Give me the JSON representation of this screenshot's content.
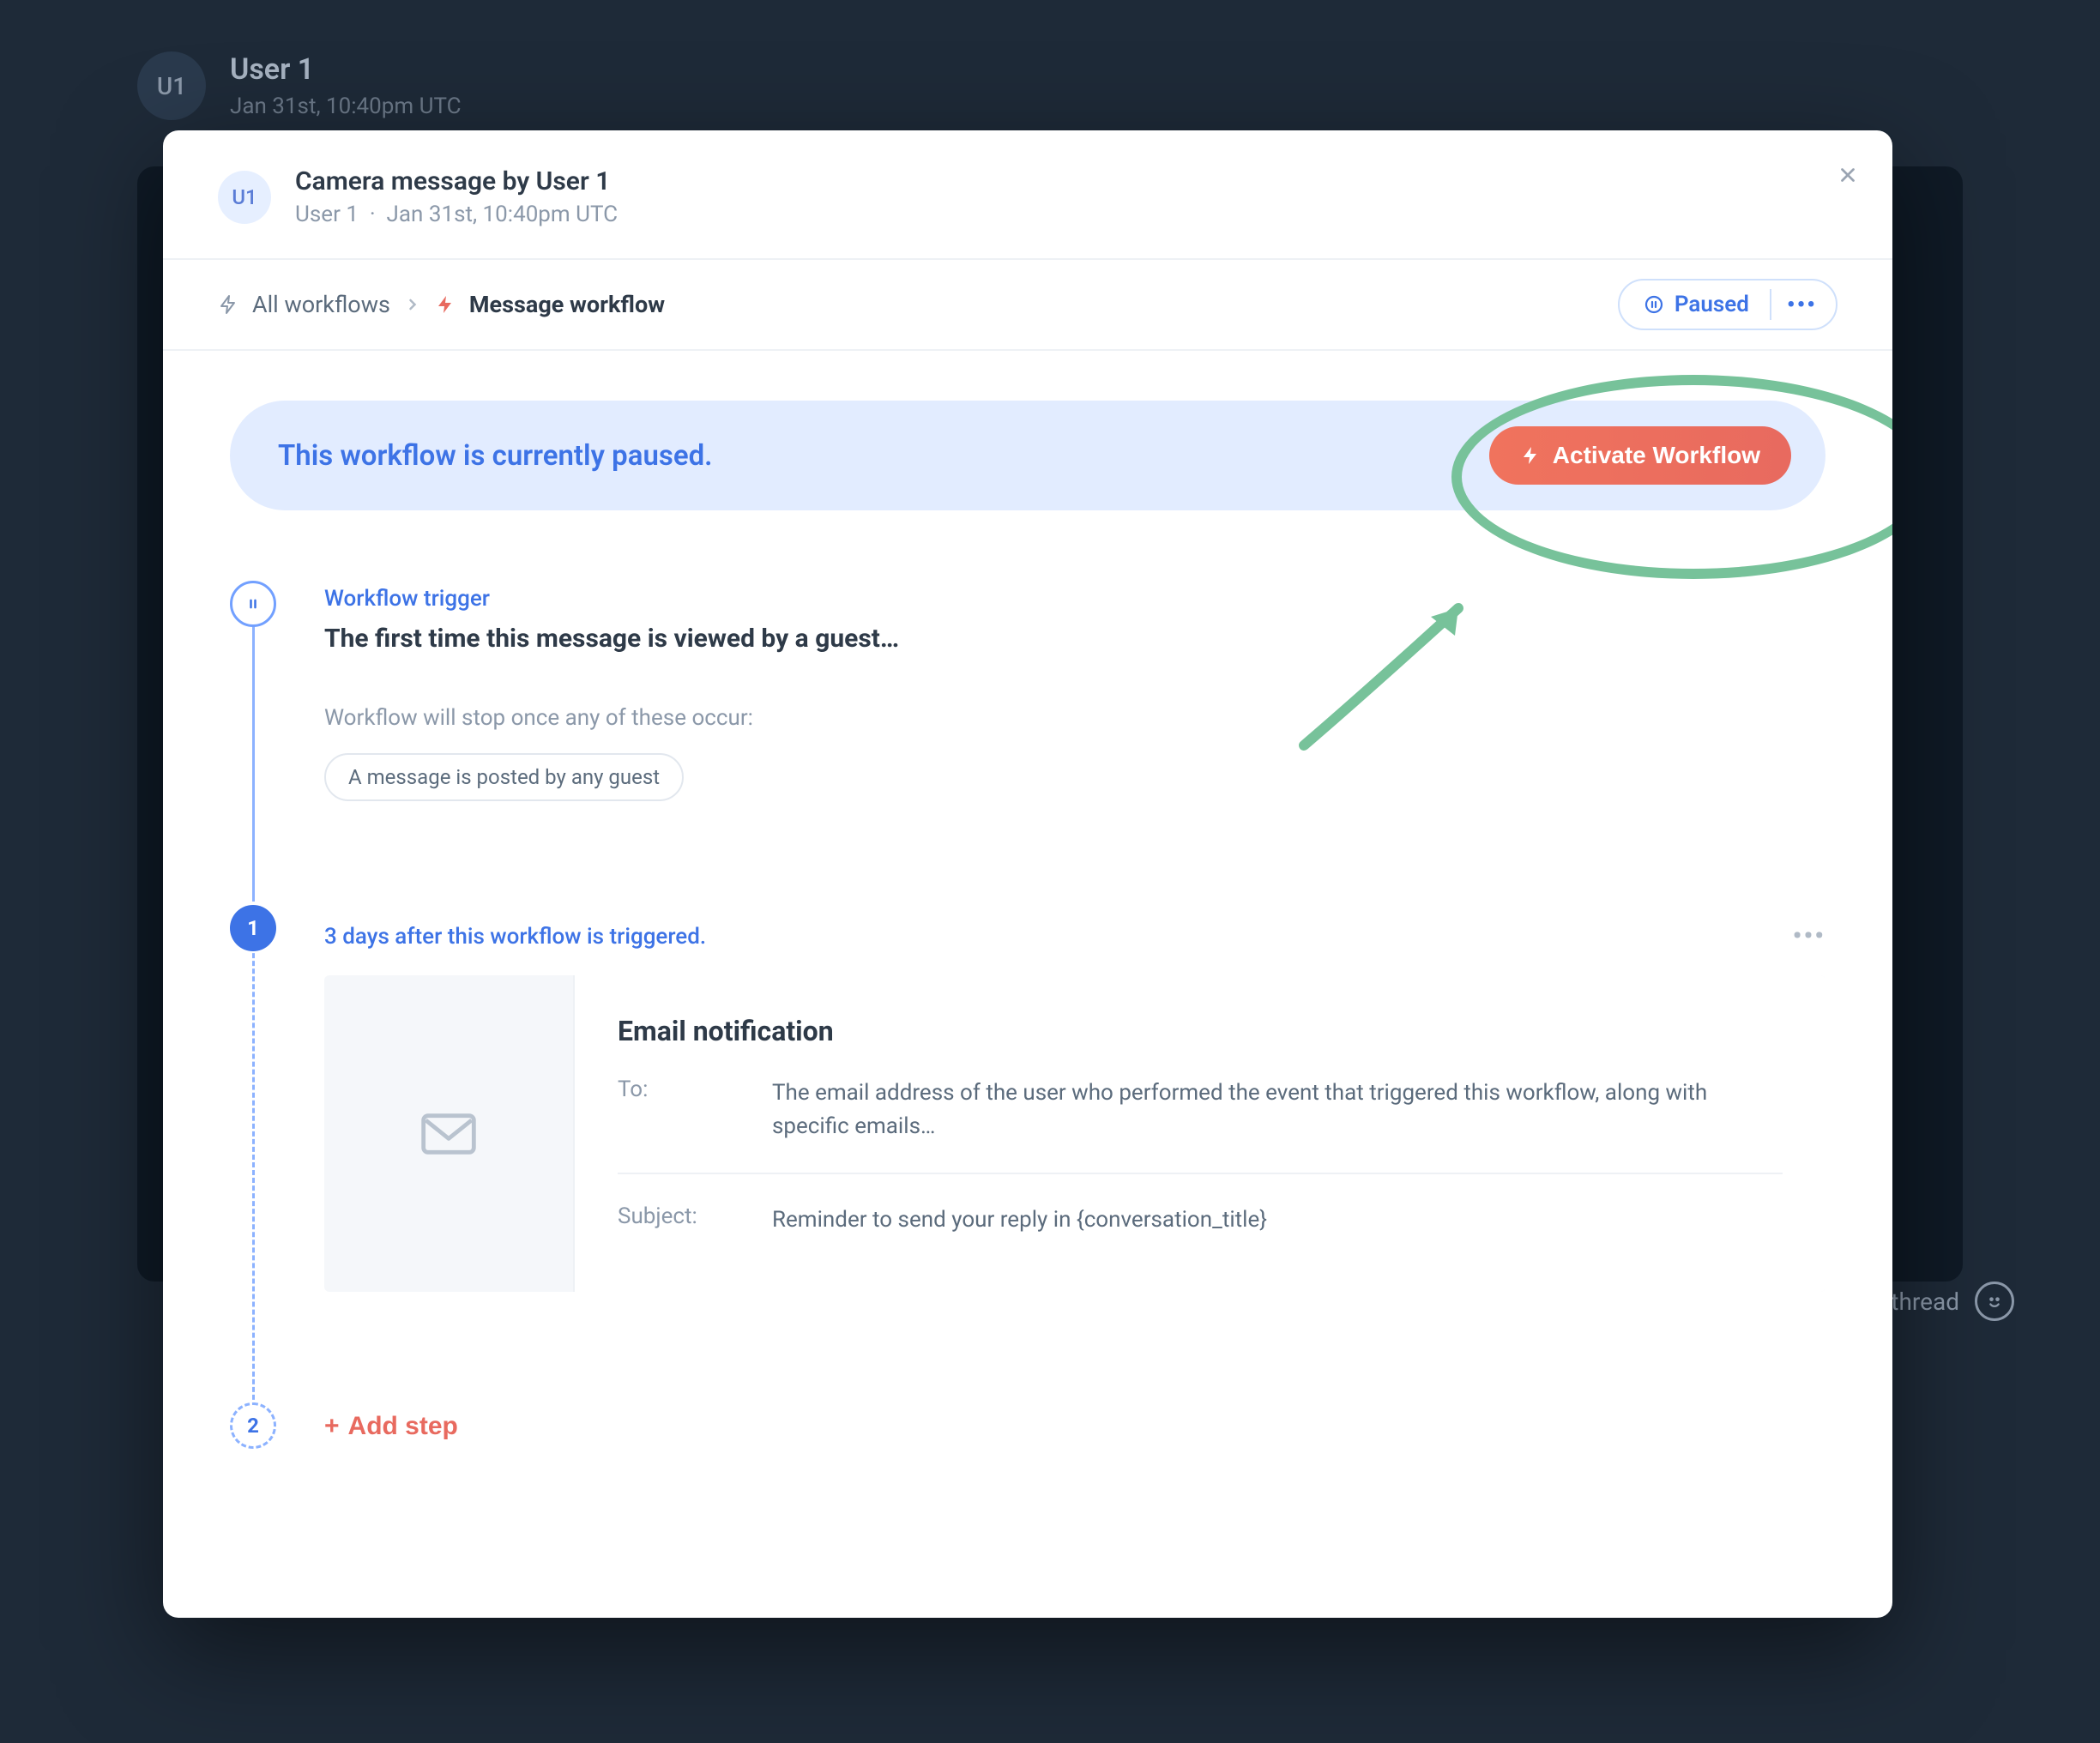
{
  "background": {
    "avatar_initials": "U1",
    "user_name": "User 1",
    "user_date": "Jan 31st, 10:40pm UTC",
    "thread_text": "t thread"
  },
  "modal": {
    "avatar_initials": "U1",
    "title": "Camera message by User 1",
    "subtitle_user": "User 1",
    "subtitle_sep": "·",
    "subtitle_date": "Jan 31st, 10:40pm UTC"
  },
  "breadcrumb": {
    "all_workflows": "All workflows",
    "current": "Message workflow"
  },
  "status": {
    "label": "Paused"
  },
  "banner": {
    "text": "This workflow is currently paused.",
    "button_label": "Activate Workflow"
  },
  "timeline": {
    "trigger": {
      "label": "Workflow trigger",
      "title": "The first time this message is viewed by a guest…",
      "stop_desc": "Workflow will stop once any of these occur:",
      "chip": "A message is posted by any guest"
    },
    "step1": {
      "node_number": "1",
      "label": "3 days after this workflow is triggered.",
      "card_title": "Email notification",
      "to_label": "To:",
      "to_value": "The email address of the user who performed the event that triggered this workflow, along with specific emails…",
      "subject_label": "Subject:",
      "subject_value": "Reminder to send your reply in {conversation_title}"
    },
    "add_step": {
      "node_number": "2",
      "label": "Add step"
    }
  }
}
